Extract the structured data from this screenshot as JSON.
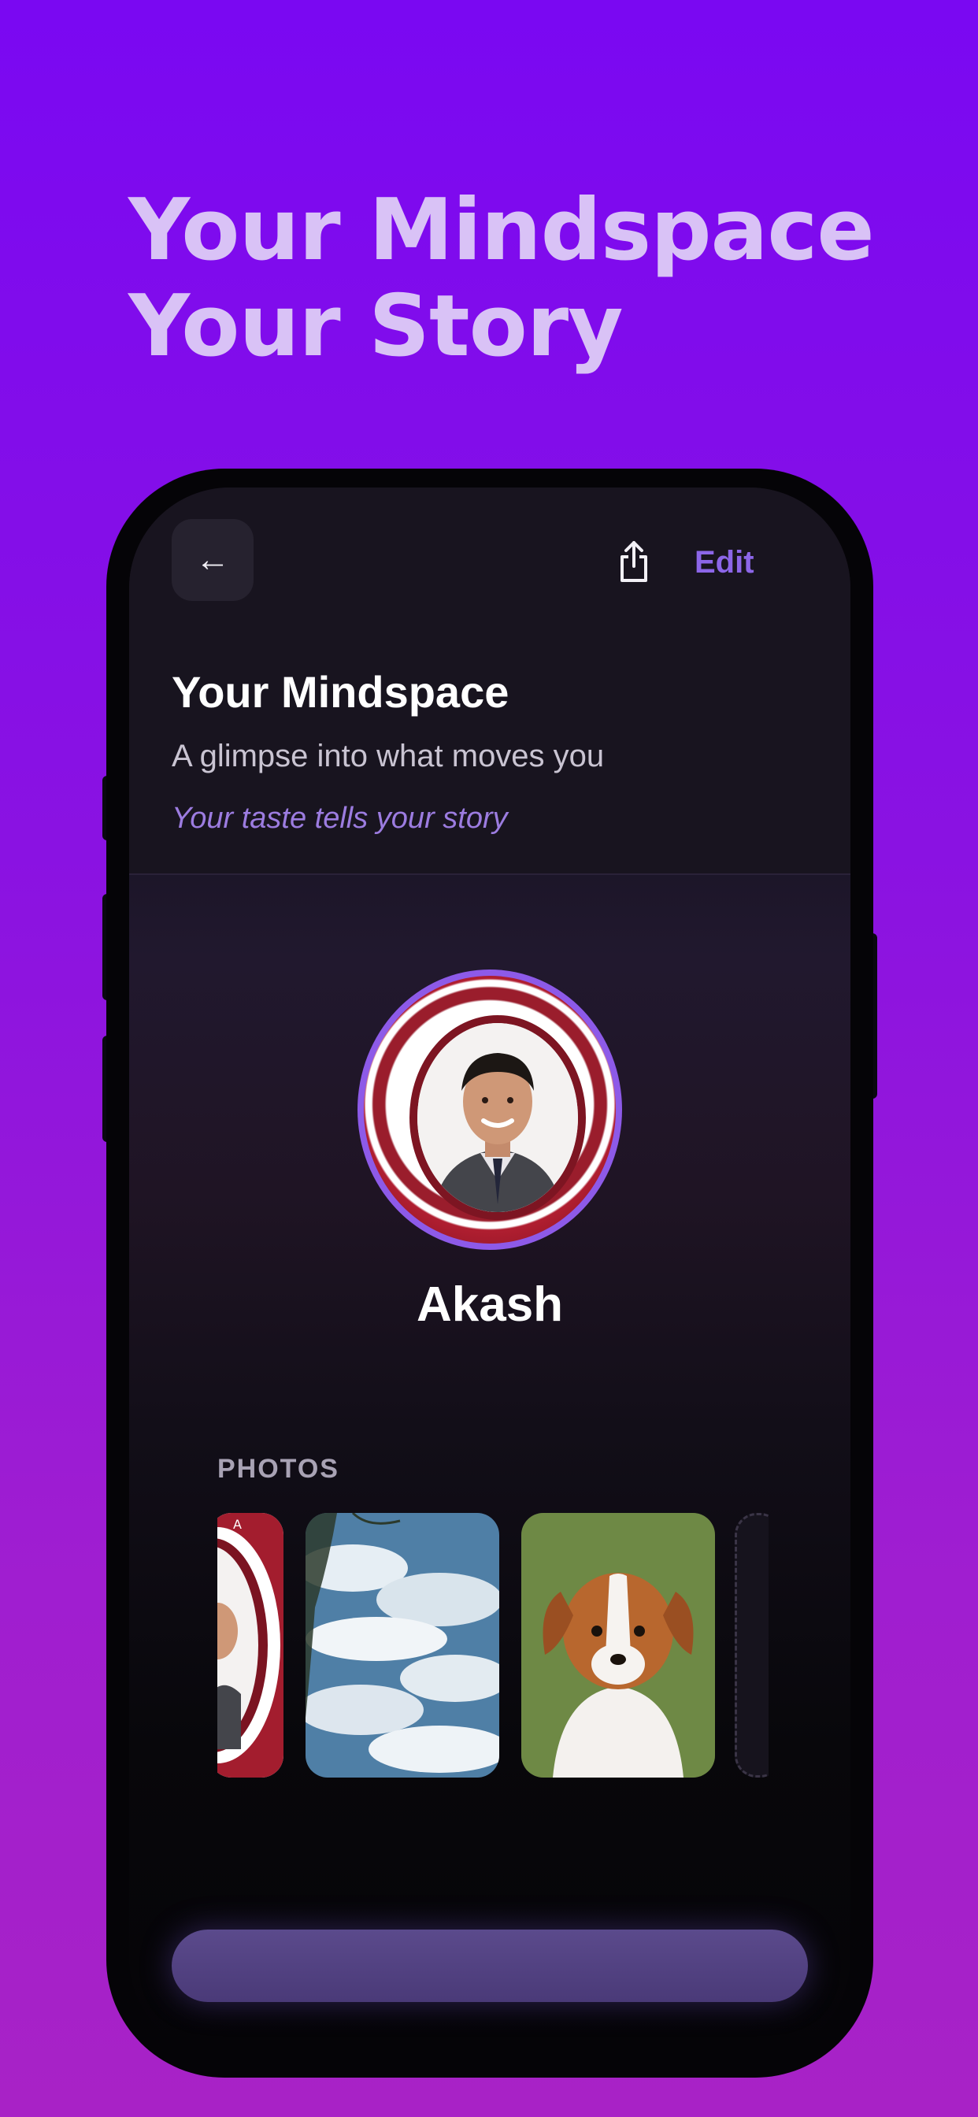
{
  "headline": {
    "line1": "Your Mindspace",
    "line2": "Your Story"
  },
  "screen": {
    "header": {
      "back_icon": "←",
      "share_icon": "share-icon",
      "edit_label": "Edit"
    },
    "title": "Your Mindspace",
    "subtitle": "A glimpse into what moves you",
    "tagline": "Your taste tells your story",
    "profile": {
      "name": "Akash"
    },
    "photos": {
      "label": "PHOTOS",
      "items": [
        "profile-photo",
        "sky-clouds-photo",
        "puppy-photo",
        "add-photo-slot"
      ]
    },
    "bottom_button": ""
  },
  "colors": {
    "background_top": "#7a08f2",
    "background_bottom": "#a822c6",
    "accent": "#8c66e8",
    "headline": "#d9c2f6"
  }
}
